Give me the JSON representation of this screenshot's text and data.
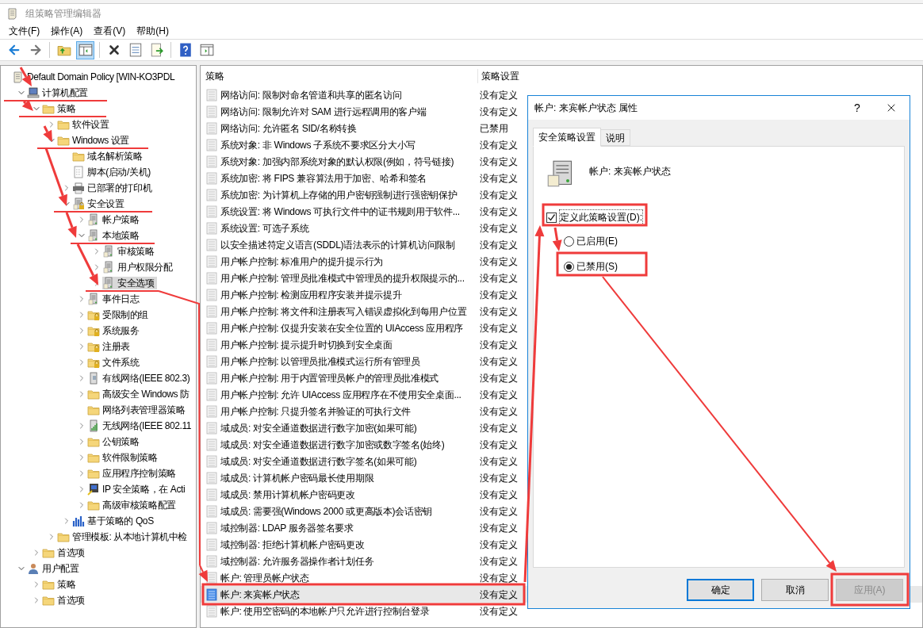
{
  "window": {
    "title": "组策略管理编辑器"
  },
  "menu": [
    "文件(F)",
    "操作(A)",
    "查看(V)",
    "帮助(H)"
  ],
  "toolbar": [
    {
      "kind": "back",
      "pressed": false
    },
    {
      "kind": "forward",
      "pressed": false
    },
    {
      "kind": "separator"
    },
    {
      "kind": "up",
      "pressed": false
    },
    {
      "kind": "tree",
      "pressed": true
    },
    {
      "kind": "separator"
    },
    {
      "kind": "delete",
      "pressed": false
    },
    {
      "kind": "properties",
      "pressed": false
    },
    {
      "kind": "export",
      "pressed": false
    },
    {
      "kind": "separator"
    },
    {
      "kind": "help",
      "pressed": false
    },
    {
      "kind": "pane",
      "pressed": false
    }
  ],
  "tree": [
    {
      "label": "Default Domain Policy [WIN-KO3PDL",
      "kind": "document",
      "selected": false,
      "children": [
        {
          "label": "计算机配置",
          "kind": "computer",
          "expanded": true,
          "selected": false,
          "children": [
            {
              "label": "策略",
              "kind": "folder",
              "expanded": true,
              "selected": false,
              "children": [
                {
                  "label": "软件设置",
                  "kind": "folder",
                  "expanded": false,
                  "selected": false
                },
                {
                  "label": "Windows 设置",
                  "kind": "folder",
                  "expanded": true,
                  "selected": false,
                  "children": [
                    {
                      "label": "域名解析策略",
                      "kind": "folder",
                      "selected": false
                    },
                    {
                      "label": "脚本(启动/关机)",
                      "kind": "script",
                      "selected": false
                    },
                    {
                      "label": "已部署的打印机",
                      "kind": "printer",
                      "expanded": false,
                      "selected": false
                    },
                    {
                      "label": "安全设置",
                      "kind": "lock-server",
                      "expanded": true,
                      "selected": false,
                      "children": [
                        {
                          "label": "帐户策略",
                          "kind": "server",
                          "expanded": false,
                          "selected": false
                        },
                        {
                          "label": "本地策略",
                          "kind": "server",
                          "expanded": true,
                          "selected": false,
                          "children": [
                            {
                              "label": "审核策略",
                              "kind": "server",
                              "expanded": false,
                              "selected": false
                            },
                            {
                              "label": "用户权限分配",
                              "kind": "server",
                              "expanded": false,
                              "selected": false
                            },
                            {
                              "label": "安全选项",
                              "kind": "server",
                              "expanded": false,
                              "selected": true
                            }
                          ]
                        },
                        {
                          "label": "事件日志",
                          "kind": "server",
                          "expanded": false,
                          "selected": false
                        },
                        {
                          "label": "受限制的组",
                          "kind": "lock-folder",
                          "expanded": false,
                          "selected": false
                        },
                        {
                          "label": "系统服务",
                          "kind": "lock-folder",
                          "expanded": false,
                          "selected": false
                        },
                        {
                          "label": "注册表",
                          "kind": "lock-folder",
                          "expanded": false,
                          "selected": false
                        },
                        {
                          "label": "文件系统",
                          "kind": "lock-folder",
                          "expanded": false,
                          "selected": false
                        },
                        {
                          "label": "有线网络(IEEE 802.3)",
                          "kind": "network",
                          "expanded": false,
                          "selected": false
                        },
                        {
                          "label": "高级安全 Windows 防",
                          "kind": "folder",
                          "expanded": false,
                          "selected": false
                        },
                        {
                          "label": "网络列表管理器策略",
                          "kind": "folder",
                          "selected": false
                        },
                        {
                          "label": "无线网络(IEEE 802.11",
                          "kind": "wireless",
                          "expanded": false,
                          "selected": false
                        },
                        {
                          "label": "公钥策略",
                          "kind": "folder",
                          "expanded": false,
                          "selected": false
                        },
                        {
                          "label": "软件限制策略",
                          "kind": "folder",
                          "expanded": false,
                          "selected": false
                        },
                        {
                          "label": "应用程序控制策略",
                          "kind": "folder",
                          "expanded": false,
                          "selected": false
                        },
                        {
                          "label": "IP 安全策略，在 Acti",
                          "kind": "ipsec",
                          "expanded": false,
                          "selected": false
                        },
                        {
                          "label": "高级审核策略配置",
                          "kind": "folder",
                          "expanded": false,
                          "selected": false
                        }
                      ]
                    },
                    {
                      "label": "基于策略的 QoS",
                      "kind": "chart",
                      "expanded": false,
                      "selected": false
                    }
                  ]
                },
                {
                  "label": "管理模板: 从本地计算机中检",
                  "kind": "folder",
                  "expanded": false,
                  "selected": false
                }
              ]
            },
            {
              "label": "首选项",
              "kind": "folder",
              "expanded": false,
              "selected": false
            }
          ]
        },
        {
          "label": "用户配置",
          "kind": "user",
          "expanded": true,
          "selected": false,
          "children": [
            {
              "label": "策略",
              "kind": "folder",
              "expanded": false,
              "selected": false
            },
            {
              "label": "首选项",
              "kind": "folder",
              "expanded": false,
              "selected": false
            }
          ]
        }
      ]
    }
  ],
  "table": {
    "columns": [
      "策略",
      "策略设置"
    ],
    "rows": [
      {
        "policy": "网络访问: 限制对命名管道和共享的匿名访问",
        "setting": "没有定义",
        "selected": false
      },
      {
        "policy": "网络访问: 限制允许对 SAM 进行远程调用的客户端",
        "setting": "没有定义",
        "selected": false
      },
      {
        "policy": "网络访问: 允许匿名 SID/名称转换",
        "setting": "已禁用",
        "selected": false
      },
      {
        "policy": "系统对象: 非 Windows 子系统不要求区分大小写",
        "setting": "没有定义",
        "selected": false
      },
      {
        "policy": "系统对象: 加强内部系统对象的默认权限(例如，符号链接)",
        "setting": "没有定义",
        "selected": false
      },
      {
        "policy": "系统加密: 将 FIPS 兼容算法用于加密、哈希和签名",
        "setting": "没有定义",
        "selected": false
      },
      {
        "policy": "系统加密: 为计算机上存储的用户密钥强制进行强密钥保护",
        "setting": "没有定义",
        "selected": false
      },
      {
        "policy": "系统设置: 将 Windows 可执行文件中的证书规则用于软件...",
        "setting": "没有定义",
        "selected": false
      },
      {
        "policy": "系统设置: 可选子系统",
        "setting": "没有定义",
        "selected": false
      },
      {
        "policy": "以安全描述符定义语言(SDDL)语法表示的计算机访问限制",
        "setting": "没有定义",
        "selected": false
      },
      {
        "policy": "用户帐户控制: 标准用户的提升提示行为",
        "setting": "没有定义",
        "selected": false
      },
      {
        "policy": "用户帐户控制: 管理员批准模式中管理员的提升权限提示的...",
        "setting": "没有定义",
        "selected": false
      },
      {
        "policy": "用户帐户控制: 检测应用程序安装并提示提升",
        "setting": "没有定义",
        "selected": false
      },
      {
        "policy": "用户帐户控制: 将文件和注册表写入错误虚拟化到每用户位置",
        "setting": "没有定义",
        "selected": false
      },
      {
        "policy": "用户帐户控制: 仅提升安装在安全位置的 UIAccess 应用程序",
        "setting": "没有定义",
        "selected": false
      },
      {
        "policy": "用户帐户控制: 提示提升时切换到安全桌面",
        "setting": "没有定义",
        "selected": false
      },
      {
        "policy": "用户帐户控制: 以管理员批准模式运行所有管理员",
        "setting": "没有定义",
        "selected": false
      },
      {
        "policy": "用户帐户控制: 用于内置管理员帐户的管理员批准模式",
        "setting": "没有定义",
        "selected": false
      },
      {
        "policy": "用户帐户控制: 允许 UIAccess 应用程序在不使用安全桌面...",
        "setting": "没有定义",
        "selected": false
      },
      {
        "policy": "用户帐户控制: 只提升签名并验证的可执行文件",
        "setting": "没有定义",
        "selected": false
      },
      {
        "policy": "域成员: 对安全通道数据进行数字加密(如果可能)",
        "setting": "没有定义",
        "selected": false
      },
      {
        "policy": "域成员: 对安全通道数据进行数字加密或数字签名(始终)",
        "setting": "没有定义",
        "selected": false
      },
      {
        "policy": "域成员: 对安全通道数据进行数字签名(如果可能)",
        "setting": "没有定义",
        "selected": false
      },
      {
        "policy": "域成员: 计算机帐户密码最长使用期限",
        "setting": "没有定义",
        "selected": false
      },
      {
        "policy": "域成员: 禁用计算机帐户密码更改",
        "setting": "没有定义",
        "selected": false
      },
      {
        "policy": "域成员: 需要强(Windows 2000 或更高版本)会话密钥",
        "setting": "没有定义",
        "selected": false
      },
      {
        "policy": "域控制器: LDAP 服务器签名要求",
        "setting": "没有定义",
        "selected": false
      },
      {
        "policy": "域控制器: 拒绝计算机帐户密码更改",
        "setting": "没有定义",
        "selected": false
      },
      {
        "policy": "域控制器: 允许服务器操作者计划任务",
        "setting": "没有定义",
        "selected": false
      },
      {
        "policy": "帐户: 管理员帐户状态",
        "setting": "没有定义",
        "selected": false
      },
      {
        "policy": "帐户: 来宾帐户状态",
        "setting": "没有定义",
        "selected": true
      },
      {
        "policy": "帐户: 使用空密码的本地帐户只允许进行控制台登录",
        "setting": "没有定义",
        "selected": false
      }
    ]
  },
  "dialog": {
    "title": "帐户: 来宾帐户状态 属性",
    "help_glyph": "?",
    "tabs": [
      {
        "label": "安全策略设置",
        "selected": true
      },
      {
        "label": "说明",
        "selected": false
      }
    ],
    "policy_name": "帐户: 来宾帐户状态",
    "define_checkbox": {
      "label": "定义此策略设置(D):",
      "checked": true
    },
    "options": [
      {
        "label": "已启用(E)",
        "selected": false
      },
      {
        "label": "已禁用(S)",
        "selected": true
      }
    ],
    "buttons": [
      {
        "label": "确定",
        "kind": "default",
        "disabled": false
      },
      {
        "label": "取消",
        "kind": "normal",
        "disabled": false
      },
      {
        "label": "应用(A)",
        "kind": "normal",
        "disabled": true
      }
    ]
  }
}
